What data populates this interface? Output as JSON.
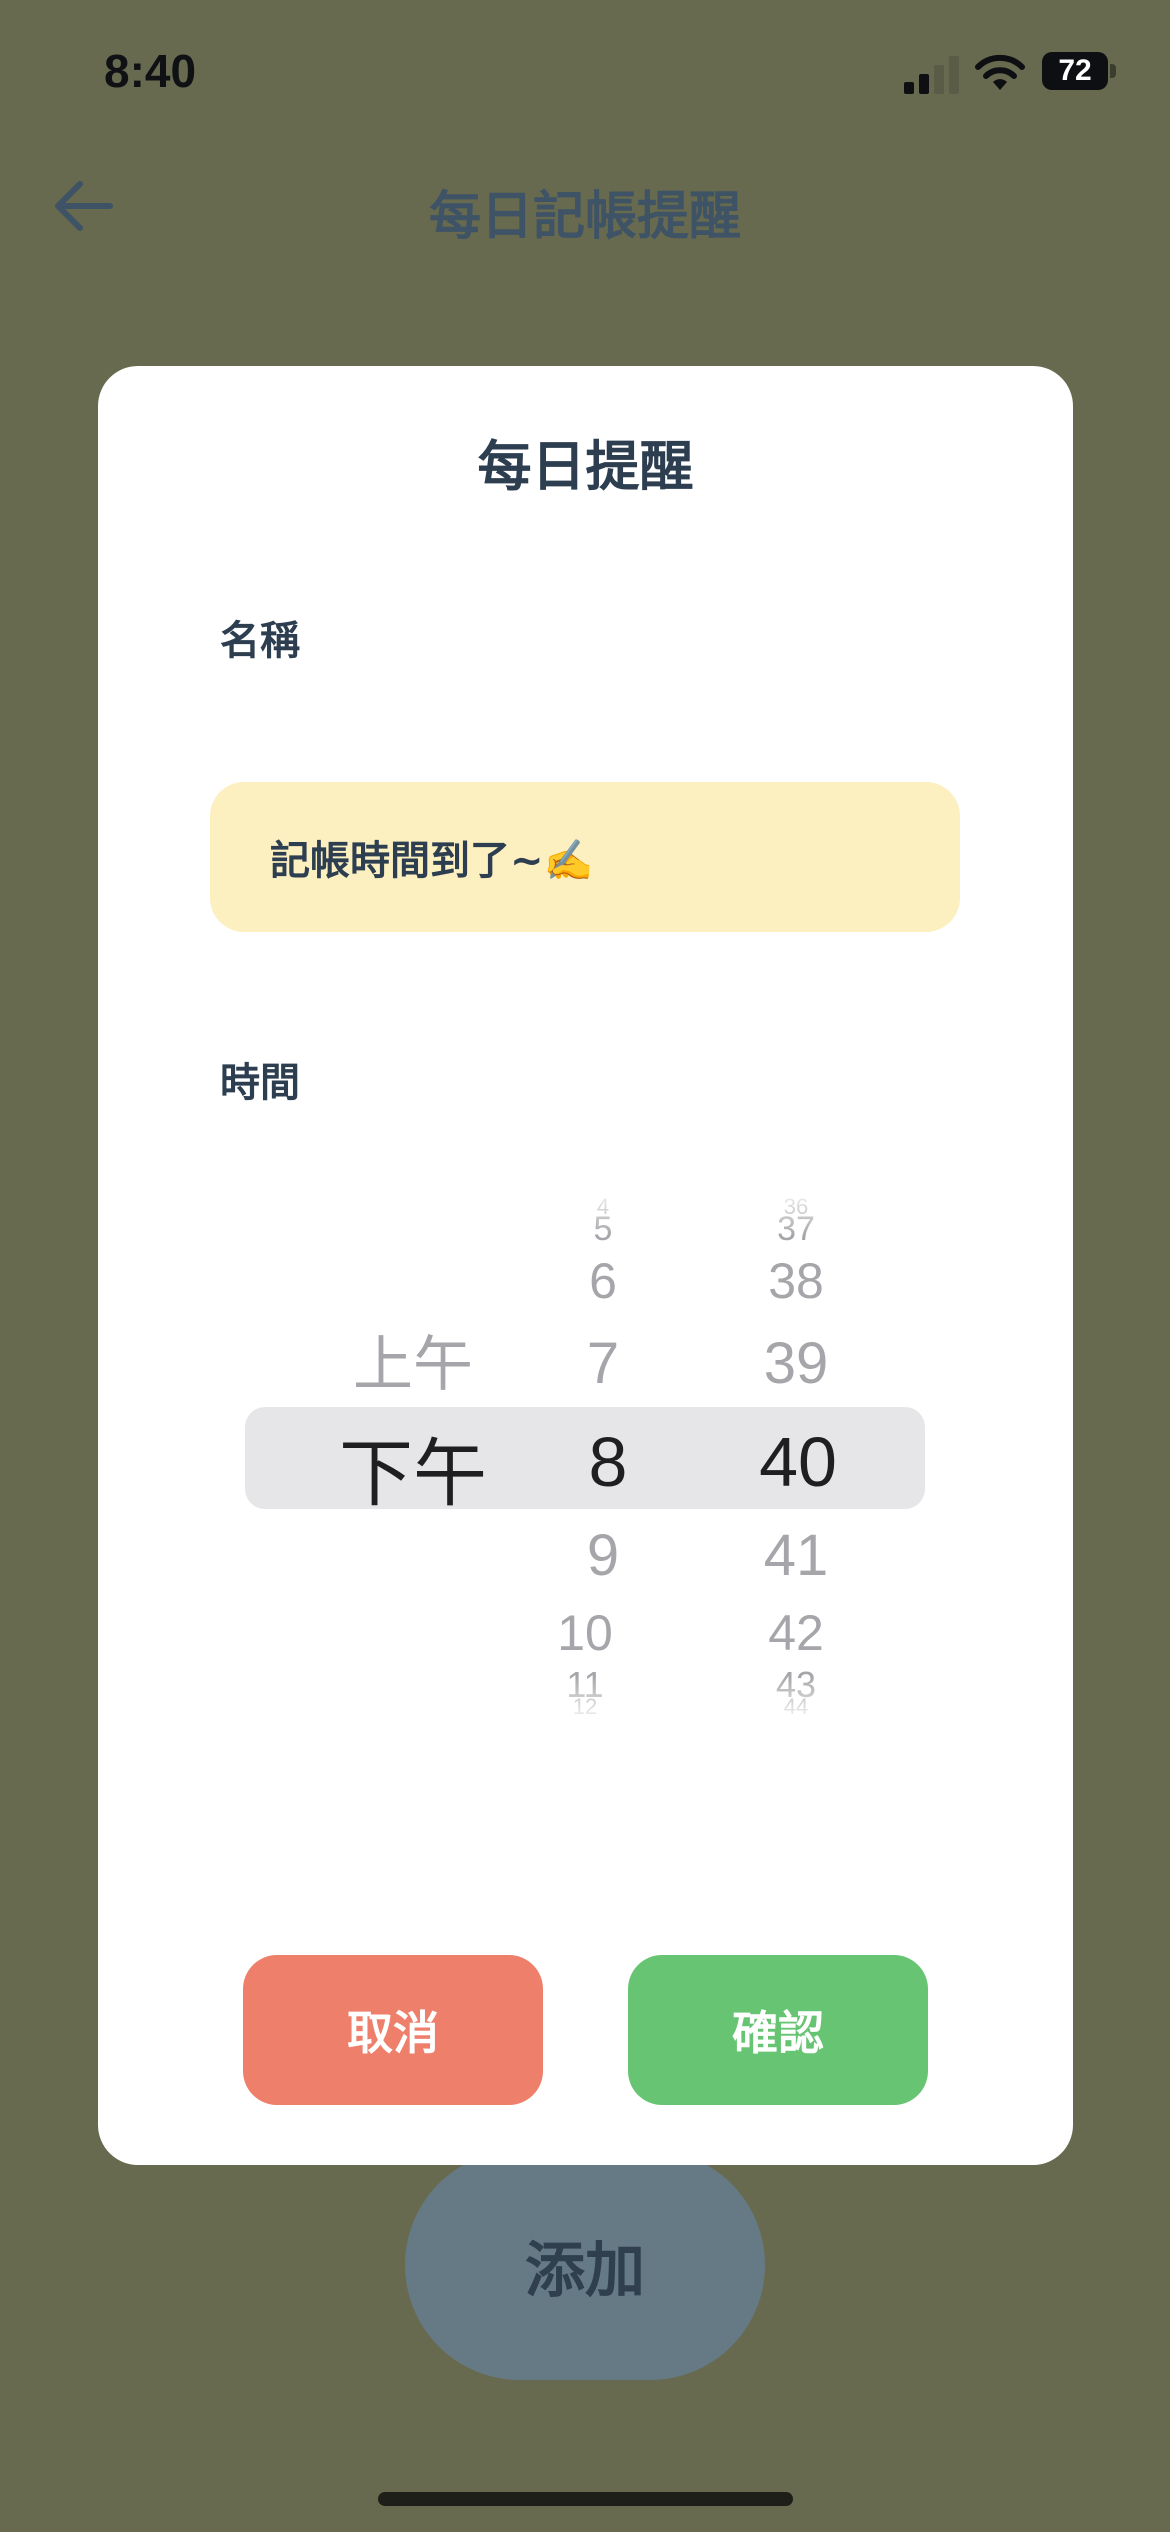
{
  "status_bar": {
    "time": "8:40",
    "battery": "72"
  },
  "header": {
    "title": "每日記帳提醒",
    "back_icon": "arrow-left-icon"
  },
  "background": {
    "add_button": "添加"
  },
  "modal": {
    "title": "每日提醒",
    "name_label": "名稱",
    "name_value": "記帳時間到了~✍️",
    "time_label": "時間",
    "picker": {
      "period": {
        "above": "上午",
        "selected": "下午"
      },
      "hours": {
        "above": [
          "4",
          "5",
          "6",
          "7"
        ],
        "selected": "8",
        "below": [
          "9",
          "10",
          "11",
          "12"
        ]
      },
      "minutes": {
        "above": [
          "36",
          "37",
          "38",
          "39"
        ],
        "selected": "40",
        "below": [
          "41",
          "42",
          "43",
          "44"
        ]
      }
    },
    "cancel_button": "取消",
    "confirm_button": "確認"
  },
  "colors": {
    "overlay_background": "#676a4e",
    "name_field_bg": "#fcf0c0",
    "cancel": "#ee7f6a",
    "confirm": "#67c472",
    "add_button": "#667a86"
  }
}
